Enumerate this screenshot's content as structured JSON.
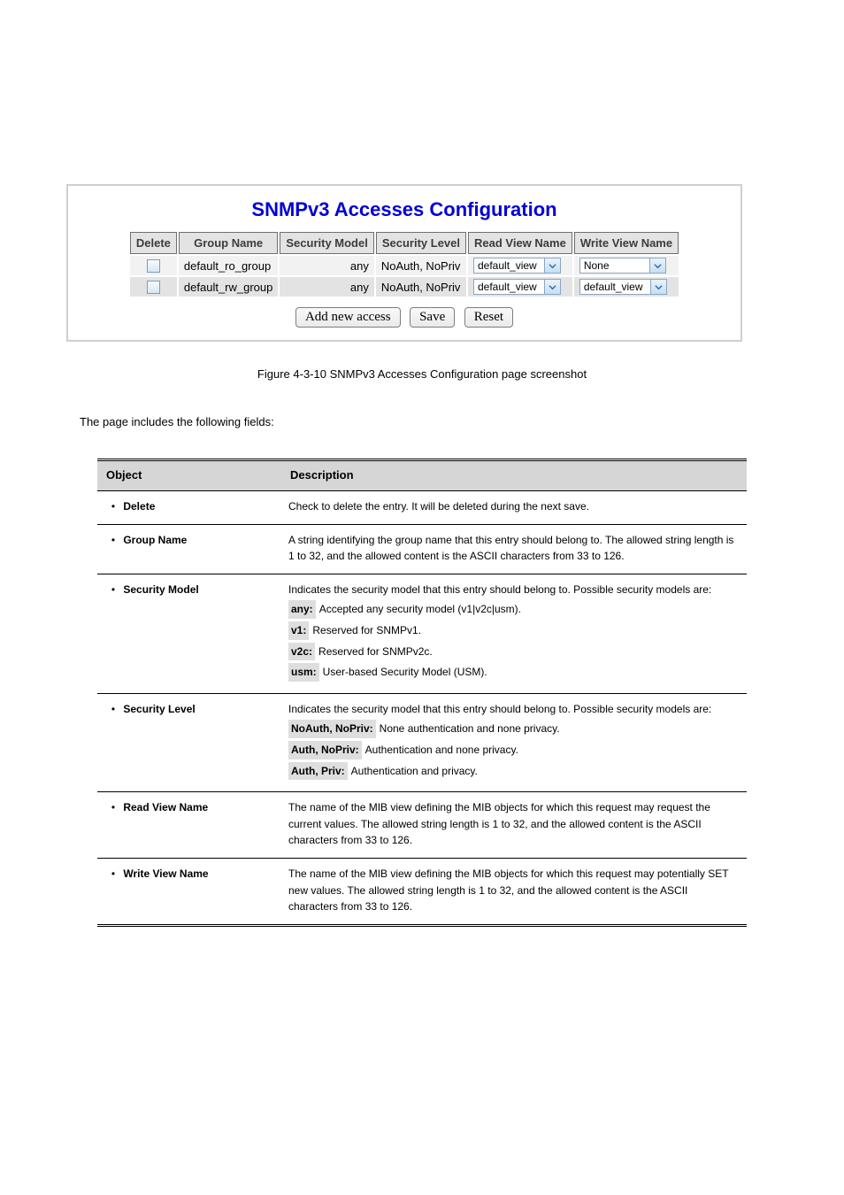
{
  "figure": {
    "title": "SNMPv3 Accesses Configuration",
    "columns": [
      "Delete",
      "Group Name",
      "Security Model",
      "Security Level",
      "Read View Name",
      "Write View Name"
    ],
    "rows": [
      {
        "group_name": "default_ro_group",
        "security_model": "any",
        "security_level": "NoAuth, NoPriv",
        "read_view": "default_view",
        "write_view": "None"
      },
      {
        "group_name": "default_rw_group",
        "security_model": "any",
        "security_level": "NoAuth, NoPriv",
        "read_view": "default_view",
        "write_view": "default_view"
      }
    ],
    "buttons": {
      "add": "Add new access",
      "save": "Save",
      "reset": "Reset"
    }
  },
  "caption": "Figure 4-3-10 SNMPv3 Accesses Configuration page screenshot",
  "intro": "The page includes the following fields:",
  "obj_table": {
    "headers": {
      "object": "Object",
      "description": "Description"
    },
    "rows": [
      {
        "object": "Delete",
        "desc": "Check to delete the entry. It will be deleted during the next save."
      },
      {
        "object": "Group Name",
        "desc": "A string identifying the group name that this entry should belong to. The allowed string length is 1 to 32, and the allowed content is the ASCII characters from 33 to 126."
      },
      {
        "object": "Security Model",
        "desc_lead": "Indicates the security model that this entry should belong to. Possible security models are:",
        "options": [
          {
            "term": "any:",
            "text": "Accepted any security model (v1|v2c|usm)."
          },
          {
            "term": "v1:",
            "text": "Reserved for SNMPv1."
          },
          {
            "term": "v2c:",
            "text": "Reserved for SNMPv2c."
          },
          {
            "term": "usm:",
            "text": "User-based Security Model (USM)."
          }
        ]
      },
      {
        "object": "Security Level",
        "desc_lead": "Indicates the security model that this entry should belong to. Possible security models are:",
        "options": [
          {
            "term": "NoAuth, NoPriv:",
            "text": "None authentication and none privacy."
          },
          {
            "term": "Auth, NoPriv:",
            "text": "Authentication and none privacy."
          },
          {
            "term": "Auth, Priv:",
            "text": "Authentication and privacy."
          }
        ]
      },
      {
        "object": "Read View Name",
        "desc": "The name of the MIB view defining the MIB objects for which this request may request the current values. The allowed string length is 1 to 32, and the allowed content is the ASCII characters from 33 to 126."
      },
      {
        "object": "Write View Name",
        "desc": "The name of the MIB view defining the MIB objects for which this request may potentially SET new values. The allowed string length is 1 to 32, and the allowed content is the ASCII characters from 33 to 126."
      }
    ]
  }
}
